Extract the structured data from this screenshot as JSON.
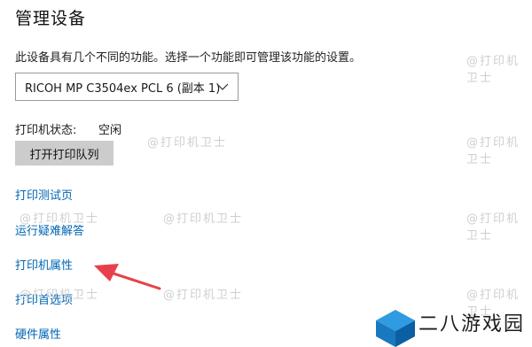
{
  "header": {
    "title": "管理设备"
  },
  "description": "此设备具有几个不同的功能。选择一个功能即可管理该功能的设置。",
  "device_select": {
    "value": "RICOH MP C3504ex PCL 6 (副本 1)",
    "icon": "chevron-down-icon"
  },
  "status": {
    "label": "打印机状态:",
    "value": "空闲"
  },
  "buttons": {
    "open_queue": "打开打印队列"
  },
  "links": {
    "test_page": "打印测试页",
    "troubleshoot": "运行疑难解答",
    "printer_properties": "打印机属性",
    "printing_preferences": "打印首选项",
    "hardware_properties": "硬件属性"
  },
  "watermark": "@打印机卫士",
  "annotation": {
    "arrow_color": "#e8404a",
    "target": "打印机属性"
  },
  "brand": {
    "name": "二八游戏园",
    "accent": "#1a8fd6"
  },
  "colors": {
    "link": "#0066b4",
    "button_bg": "#cccccc"
  }
}
